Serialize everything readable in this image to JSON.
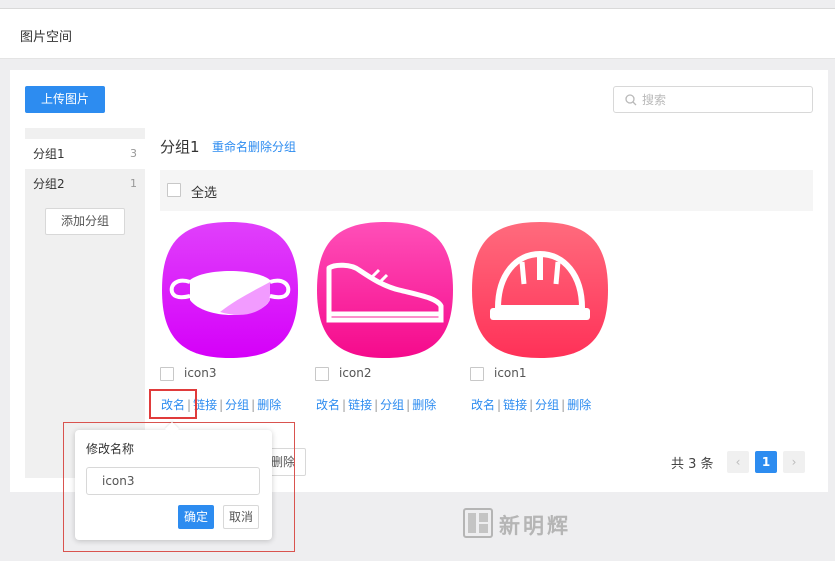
{
  "header": {
    "title": "图片空间"
  },
  "toolbar": {
    "upload_label": "上传图片",
    "search_placeholder": "搜索"
  },
  "sidebar": {
    "groups": [
      {
        "label": "分组1",
        "count": "3"
      },
      {
        "label": "分组2",
        "count": "1"
      }
    ],
    "add_group_label": "添加分组"
  },
  "main": {
    "group_title": "分组1",
    "rename_label": "重命名",
    "delete_group_label": "删除分组",
    "select_all_label": "全选",
    "items": [
      {
        "name": "icon3",
        "icon": "mask-icon",
        "color_top": "#e040fb",
        "color_bottom": "#d500f9"
      },
      {
        "name": "icon2",
        "icon": "shoe-icon",
        "color_top": "#ff4fb8",
        "color_bottom": "#f50a8c"
      },
      {
        "name": "icon1",
        "icon": "helmet-icon",
        "color_top": "#ff6b7d",
        "color_bottom": "#ff3158"
      }
    ],
    "ops": {
      "rename": "改名",
      "link": "链接",
      "group": "分组",
      "delete": "删除",
      "sep": "|"
    },
    "batch_delete_label": "删除"
  },
  "pagination": {
    "total_text": "共 3 条",
    "prev": "‹",
    "current": "1",
    "next": "›"
  },
  "popover": {
    "title": "修改名称",
    "value": "icon3",
    "ok_label": "确定",
    "cancel_label": "取消"
  },
  "watermark": {
    "text": "新明辉"
  }
}
